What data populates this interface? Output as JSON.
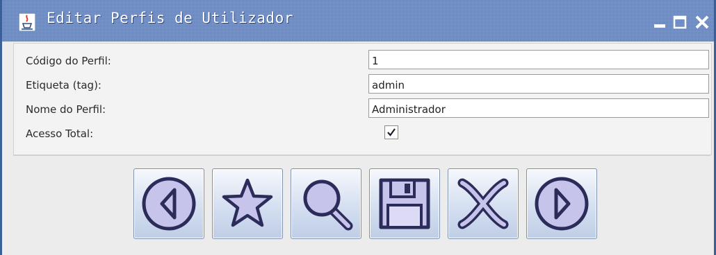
{
  "window": {
    "title": "Editar Perfis de Utilizador",
    "title_bar_color": "#6a8cc8",
    "controls": [
      "minimize-icon",
      "maximize-icon",
      "close-icon"
    ]
  },
  "form": {
    "fields": [
      {
        "label": "Código do Perfil:",
        "value": "1"
      },
      {
        "label": "Etiqueta (tag):",
        "value": "admin"
      },
      {
        "label": "Nome do Perfil:",
        "value": "Administrador"
      }
    ],
    "full_access": {
      "label": "Acesso Total:",
      "checked": true
    }
  },
  "toolbar": {
    "buttons": [
      {
        "name": "previous",
        "icon": "arrow-left-circle-icon"
      },
      {
        "name": "new",
        "icon": "star-icon"
      },
      {
        "name": "search",
        "icon": "magnifier-icon"
      },
      {
        "name": "save",
        "icon": "floppy-disk-icon"
      },
      {
        "name": "delete",
        "icon": "x-icon"
      },
      {
        "name": "next",
        "icon": "arrow-right-circle-icon"
      }
    ],
    "icon_fill": "#c6c4ea",
    "icon_stroke": "#2c2c5a"
  }
}
